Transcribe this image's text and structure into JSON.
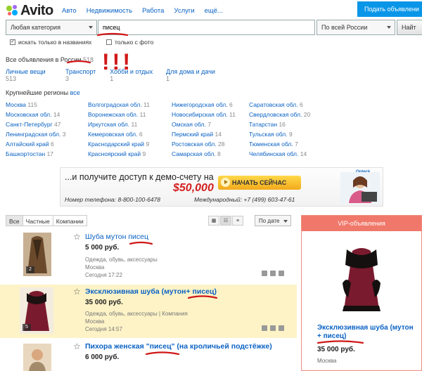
{
  "header": {
    "logo": "Avito",
    "nav": [
      "Авто",
      "Недвижимость",
      "Работа",
      "Услуги",
      "ещё..."
    ],
    "post_button": "Подать объявлени"
  },
  "search": {
    "category": "Любая категория",
    "query": "писец",
    "region": "По всей России",
    "find_button": "Найт",
    "only_titles": "искать только в названиях",
    "only_photo": "только с фото"
  },
  "summary": {
    "label": "Все объявления в России",
    "count": "518"
  },
  "categories": [
    {
      "name": "Личные вещи",
      "count": "513"
    },
    {
      "name": "Транспорт",
      "count": "3"
    },
    {
      "name": "Хобби и отдых",
      "count": "1"
    },
    {
      "name": "Для дома и дачи",
      "count": "1"
    }
  ],
  "annotation": "!!!",
  "regions_title": "Крупнейшие регионы",
  "regions_all": "все",
  "regions": [
    {
      "name": "Москва",
      "count": "115"
    },
    {
      "name": "Волгоградская обл.",
      "count": "11"
    },
    {
      "name": "Нижегородская обл.",
      "count": "6"
    },
    {
      "name": "Саратовская обл.",
      "count": "6"
    },
    {
      "name": "Московская обл.",
      "count": "14"
    },
    {
      "name": "Воронежская обл.",
      "count": "11"
    },
    {
      "name": "Новосибирская обл.",
      "count": "11"
    },
    {
      "name": "Свердловская обл.",
      "count": "20"
    },
    {
      "name": "Санкт-Петербург",
      "count": "47"
    },
    {
      "name": "Иркутская обл.",
      "count": "11"
    },
    {
      "name": "Омская обл.",
      "count": "7"
    },
    {
      "name": "Татарстан",
      "count": "16"
    },
    {
      "name": "Ленинградская обл.",
      "count": "3"
    },
    {
      "name": "Кемеровская обл.",
      "count": "6"
    },
    {
      "name": "Пермский край",
      "count": "14"
    },
    {
      "name": "Тульская обл.",
      "count": "9"
    },
    {
      "name": "Алтайский край",
      "count": "6"
    },
    {
      "name": "Краснодарский край",
      "count": "9"
    },
    {
      "name": "Ростовская обл.",
      "count": "28"
    },
    {
      "name": "Тюменская обл.",
      "count": "7"
    },
    {
      "name": "Башкортостан",
      "count": "17"
    },
    {
      "name": "Красноярский край",
      "count": "9"
    },
    {
      "name": "Самарская обл.",
      "count": "8"
    },
    {
      "name": "Челябинская обл.",
      "count": "14"
    }
  ],
  "banner": {
    "promo": "...и получите доступ к демо-счету на",
    "amount": "$50,000",
    "cta": "НАЧАТЬ СЕЙЧАС",
    "phone": "Номер телефона: 8-800-100-6478",
    "intl": "Международный: +7 (499) 603-47-61",
    "brand": "Opteck"
  },
  "list_tabs": [
    "Все",
    "Частные",
    "Компании"
  ],
  "sort": "По дате",
  "listings": [
    {
      "title": "Шуба мутон писец",
      "price": "5 000 руб.",
      "category": "Одежда, обувь, аксессуары",
      "city": "Москва",
      "date": "Сегодня 17:22",
      "photos": "2"
    },
    {
      "title": "Эксклюзивная шуба (мутон+ писец)",
      "price": "35 000 руб.",
      "category": "Одежда, обувь, аксессуары | Компания",
      "city": "Москва",
      "date": "Сегодня 14:57",
      "photos": "5"
    },
    {
      "title": "Пихора женская \"писец\" (на кроличьей подстёжке)",
      "price": "6 000 руб.",
      "category": "",
      "city": "",
      "date": "",
      "photos": ""
    }
  ],
  "vip": {
    "header": "VIP-объявления",
    "title": "Эксклюзивная шуба (мутон + писец)",
    "price": "35 000 руб.",
    "city": "Москва"
  },
  "colors": {
    "link": "#0a62c4",
    "accent": "#0a96e8",
    "annotation_red": "#d01818",
    "highlight": "#fdf3c6"
  }
}
